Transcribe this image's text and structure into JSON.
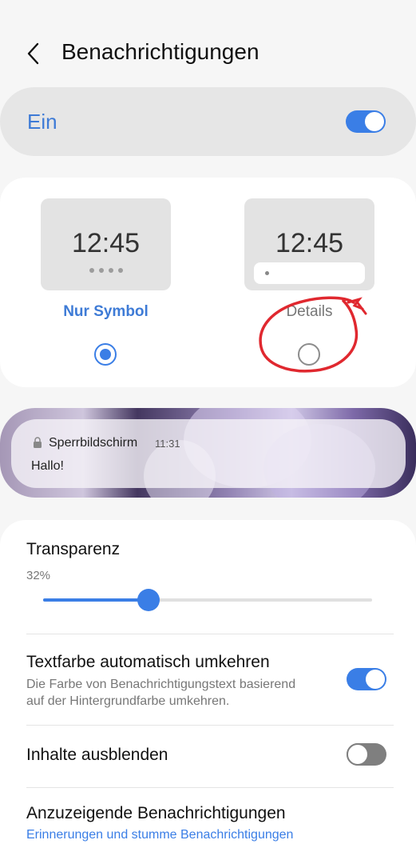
{
  "header": {
    "title": "Benachrichtigungen"
  },
  "master_toggle": {
    "label": "Ein",
    "state": true
  },
  "style_options": [
    {
      "label": "Nur Symbol",
      "time": "12:45",
      "selected": true
    },
    {
      "label": "Details",
      "time": "12:45",
      "selected": false
    }
  ],
  "preview_notification": {
    "app": "Sperrbildschirm",
    "time": "11:31",
    "text": "Hallo!"
  },
  "settings": {
    "transparency": {
      "label": "Transparenz",
      "value_text": "32%",
      "value": 0.32
    },
    "invert_text": {
      "title": "Textfarbe automatisch umkehren",
      "subtitle_line1": "Die Farbe von Benachrichtigungstext basierend",
      "subtitle_line2": "auf der Hintergrundfarbe umkehren.",
      "state": true
    },
    "hide_content": {
      "title": "Inhalte ausblenden",
      "state": false
    },
    "notifications_to_show": {
      "title": "Anzuzeigende Benachrichtigungen",
      "value": "Erinnerungen und stumme Benachrichtigungen"
    }
  },
  "colors": {
    "accent": "#3a7ee6",
    "annotation": "#e0282f"
  }
}
